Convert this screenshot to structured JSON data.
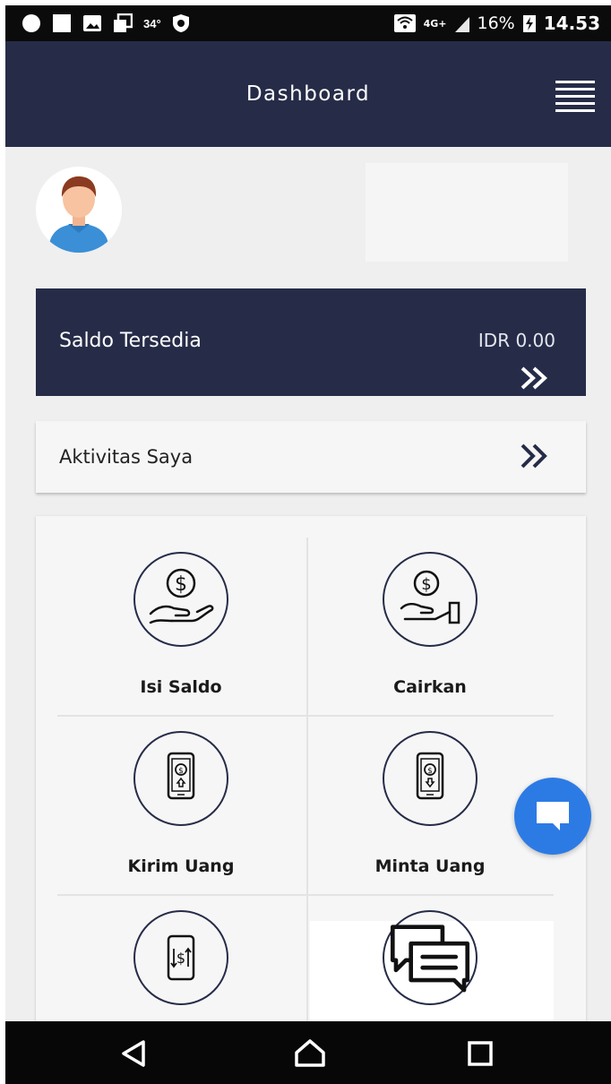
{
  "status_bar": {
    "temperature": "34°",
    "network": "4G+",
    "battery": "16%",
    "time": "14.53"
  },
  "header": {
    "title": "Dashboard",
    "menu_icon": "hamburger-menu-icon"
  },
  "balance": {
    "label": "Saldo Tersedia",
    "value": "IDR 0.00"
  },
  "activity": {
    "label": "Aktivitas Saya"
  },
  "menu": {
    "items": [
      {
        "label": "Isi Saldo",
        "icon": "hand-dollar-icon"
      },
      {
        "label": "Cairkan",
        "icon": "cash-out-hand-icon"
      },
      {
        "label": "Kirim Uang",
        "icon": "phone-send-money-icon"
      },
      {
        "label": "Minta Uang",
        "icon": "phone-request-money-icon"
      },
      {
        "label": "",
        "icon": "phone-transfer-icon"
      },
      {
        "label": "",
        "icon": "chat-messages-icon"
      }
    ]
  },
  "colors": {
    "primary": "#262c48",
    "background": "#efefef",
    "fab": "#2c7be5"
  }
}
